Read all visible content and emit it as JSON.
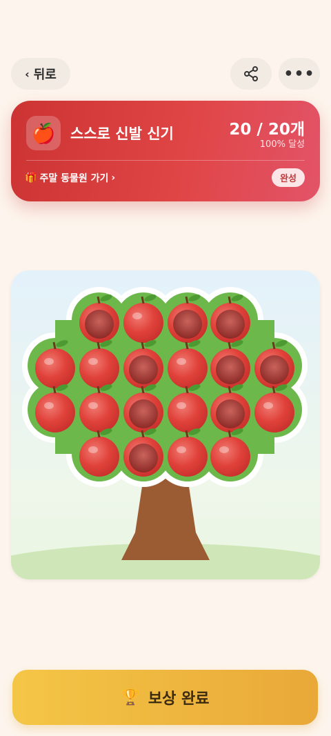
{
  "nav": {
    "back_label": "뒤로",
    "back_icon": "chevron-left-icon",
    "share_icon": "share-icon",
    "more_icon": "more-dots-icon"
  },
  "goal": {
    "icon": "🍎",
    "title": "스스로 신발 신기",
    "count": "20 / 20개",
    "percent": "100% 달성",
    "reward_icon": "🎁",
    "reward_label": "주말 동물원 가기",
    "reward_chevron": "›",
    "status_badge": "완성"
  },
  "tree": {
    "total_apples": 20,
    "filled_apples": 20,
    "apple_color": "#e0423a",
    "leaf_color": "#6cb84a",
    "trunk_color": "#9b5c34"
  },
  "action": {
    "icon": "🏆",
    "label": "보상 완료"
  },
  "colors": {
    "card_red": "#d93c3c",
    "button_gold": "#efb63f",
    "background": "#fdf5ed"
  }
}
